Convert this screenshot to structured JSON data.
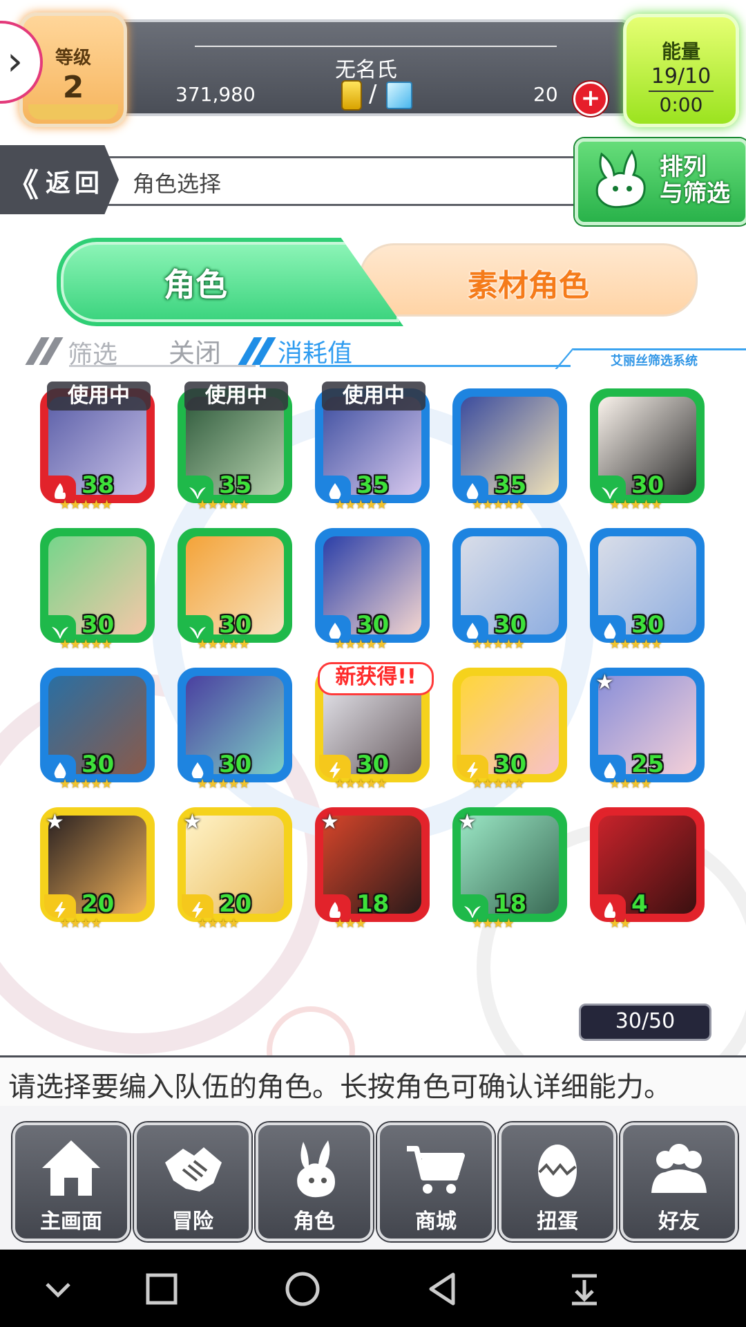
{
  "header": {
    "level_label": "等级",
    "level_value": "2",
    "player_name": "无名氏",
    "coins": "371,980",
    "currency_separator": "/",
    "gems": "20",
    "plus_symbol": "+",
    "energy_label": "能量",
    "energy_value": "19/10",
    "energy_timer": "0:00"
  },
  "nav": {
    "back_label": "返回",
    "back_arrow": "《",
    "title": "角色选择",
    "sort_filter_label_1": "排列",
    "sort_filter_label_2": "与筛选"
  },
  "tabs": [
    {
      "label": "角色",
      "active": true
    },
    {
      "label": "素材角色",
      "active": false
    }
  ],
  "filter": {
    "label": "筛选",
    "state": "关闭",
    "sort_by": "消耗值",
    "system_name": "艾丽丝筛选系统"
  },
  "characters": [
    {
      "level": "38",
      "stars": 5,
      "element": "fire",
      "frame": "#e2232b",
      "badge": "使用中"
    },
    {
      "level": "35",
      "stars": 5,
      "element": "wind",
      "frame": "#1fb94a",
      "badge": "使用中"
    },
    {
      "level": "35",
      "stars": 5,
      "element": "water",
      "frame": "#1e84e0",
      "badge": "使用中"
    },
    {
      "level": "35",
      "stars": 5,
      "element": "water",
      "frame": "#1e84e0",
      "badge": ""
    },
    {
      "level": "30",
      "stars": 5,
      "element": "wind",
      "frame": "#1fb94a",
      "badge": ""
    },
    {
      "level": "30",
      "stars": 5,
      "element": "wind",
      "frame": "#1fb94a",
      "badge": ""
    },
    {
      "level": "30",
      "stars": 5,
      "element": "wind",
      "frame": "#1fb94a",
      "badge": ""
    },
    {
      "level": "30",
      "stars": 5,
      "element": "water",
      "frame": "#1e84e0",
      "badge": ""
    },
    {
      "level": "30",
      "stars": 5,
      "element": "water",
      "frame": "#1e84e0",
      "badge": ""
    },
    {
      "level": "30",
      "stars": 5,
      "element": "water",
      "frame": "#1e84e0",
      "badge": ""
    },
    {
      "level": "30",
      "stars": 5,
      "element": "water",
      "frame": "#1e84e0",
      "badge": ""
    },
    {
      "level": "30",
      "stars": 5,
      "element": "water",
      "frame": "#1e84e0",
      "badge": ""
    },
    {
      "level": "30",
      "stars": 5,
      "element": "thunder",
      "frame": "#f5d21c",
      "badge": "新获得!!"
    },
    {
      "level": "30",
      "stars": 5,
      "element": "thunder",
      "frame": "#f5d21c",
      "badge": ""
    },
    {
      "level": "25",
      "stars": 4,
      "element": "water",
      "frame": "#1e84e0",
      "badge": "★"
    },
    {
      "level": "20",
      "stars": 4,
      "element": "thunder",
      "frame": "#f5d21c",
      "badge": "★"
    },
    {
      "level": "20",
      "stars": 4,
      "element": "thunder",
      "frame": "#f5d21c",
      "badge": "★"
    },
    {
      "level": "18",
      "stars": 3,
      "element": "fire",
      "frame": "#e2232b",
      "badge": "★"
    },
    {
      "level": "18",
      "stars": 4,
      "element": "wind",
      "frame": "#1fb94a",
      "badge": "★"
    },
    {
      "level": "4",
      "stars": 2,
      "element": "fire",
      "frame": "#e2232b",
      "badge": ""
    }
  ],
  "box_count": "30/50",
  "hint_text": "请选择要编入队伍的角色。长按角色可确认详细能力。",
  "bottom_nav": [
    {
      "label": "主画面",
      "icon": "home-icon"
    },
    {
      "label": "冒险",
      "icon": "handshake-icon"
    },
    {
      "label": "角色",
      "icon": "bunny-icon"
    },
    {
      "label": "商城",
      "icon": "cart-icon"
    },
    {
      "label": "扭蛋",
      "icon": "egg-icon"
    },
    {
      "label": "好友",
      "icon": "friends-icon"
    }
  ],
  "system_nav": [
    "chevron-down-icon",
    "square-icon",
    "circle-icon",
    "back-triangle-icon",
    "notification-pull-icon"
  ]
}
